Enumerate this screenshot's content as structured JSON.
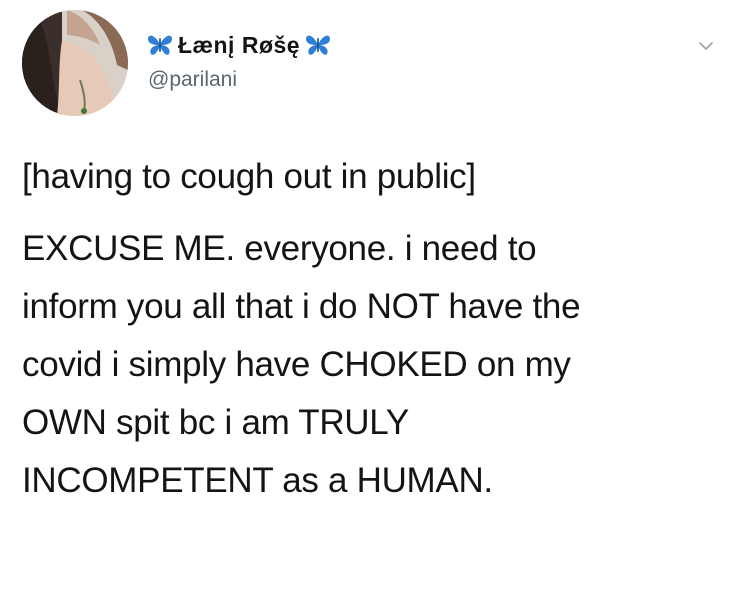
{
  "author": {
    "display_name": "Łænį Røšę",
    "handle": "@parilani",
    "name_decoration_icon": "blue-butterfly-icon",
    "verified": false
  },
  "menu": {
    "icon": "chevron-down-icon"
  },
  "tweet": {
    "lines": [
      "[having to cough out in public]",
      "EXCUSE ME. everyone. i need to",
      "inform you all that i do NOT have the",
      "covid i simply have CHOKED on my",
      "OWN spit bc i am TRULY",
      "INCOMPETENT as a HUMAN."
    ]
  },
  "colors": {
    "text": "#141414",
    "handle": "#5b6670",
    "butterfly": "#2f7fd6",
    "chevron": "#9aa4ad"
  }
}
